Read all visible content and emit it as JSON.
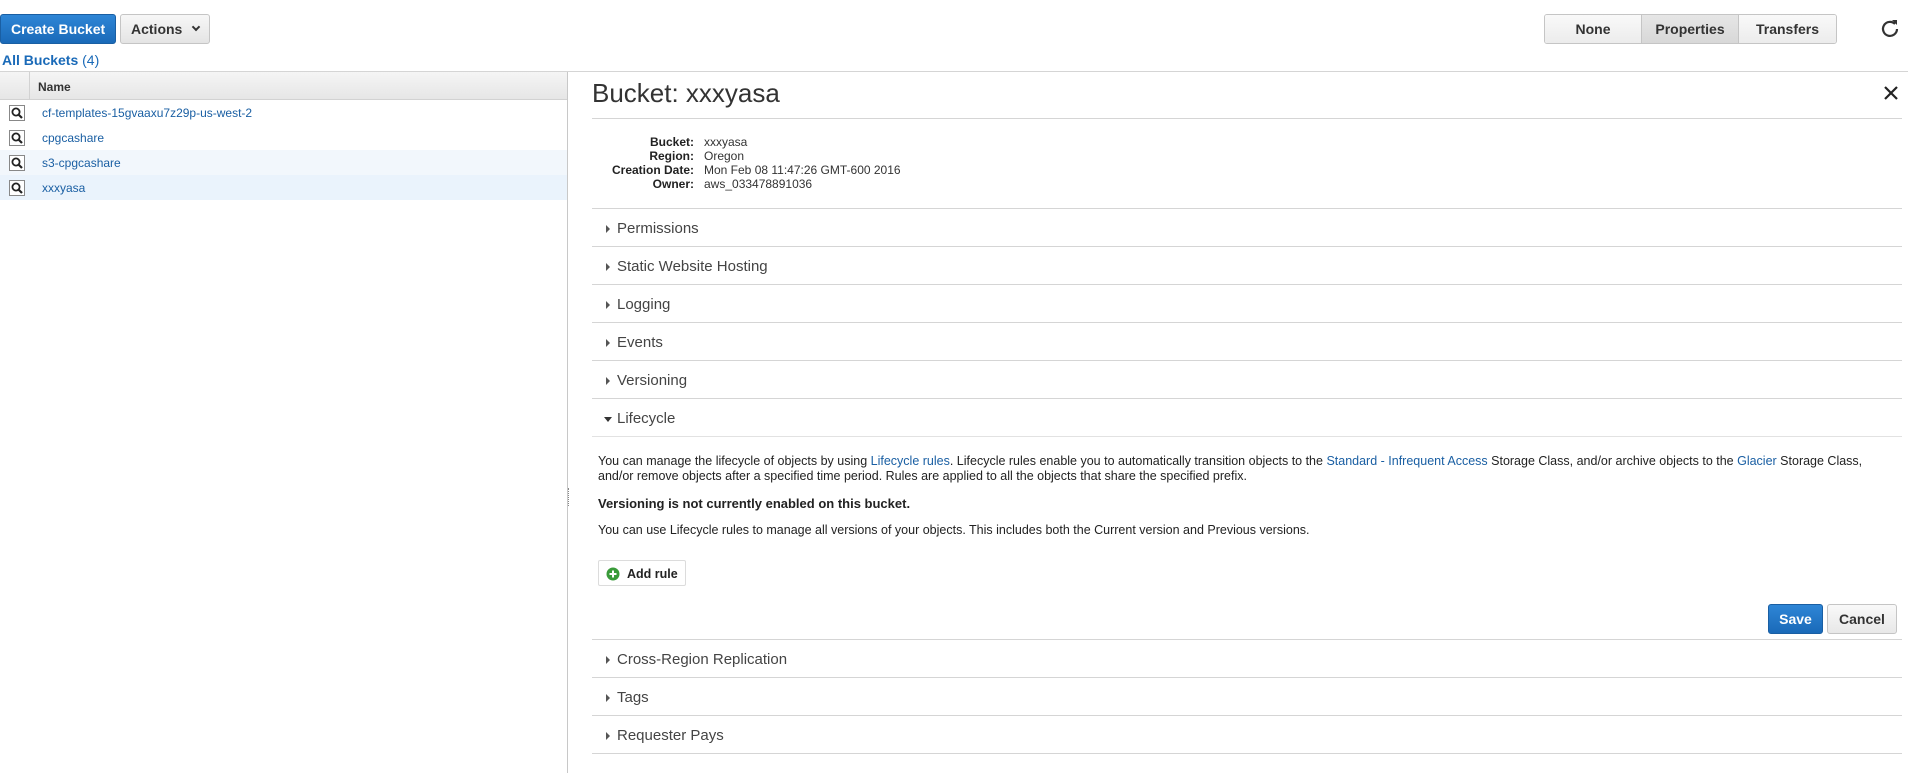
{
  "toolbar": {
    "create_bucket": "Create Bucket",
    "actions": "Actions",
    "view_tabs": [
      "None",
      "Properties",
      "Transfers"
    ],
    "active_tab": "Properties"
  },
  "all_buckets": {
    "label": "All Buckets",
    "count": "(4)"
  },
  "table": {
    "header_name": "Name",
    "rows": [
      "cf-templates-15gvaaxu7z29p-us-west-2",
      "cpgcashare",
      "s3-cpgcashare",
      "xxxyasa"
    ]
  },
  "details": {
    "title": "Bucket: xxxyasa",
    "meta": {
      "bucket_label": "Bucket:",
      "bucket_value": "xxxyasa",
      "region_label": "Region:",
      "region_value": "Oregon",
      "creation_label": "Creation Date:",
      "creation_value": "Mon Feb 08 11:47:26 GMT-600 2016",
      "owner_label": "Owner:",
      "owner_value": "aws_033478891036"
    },
    "sections": {
      "permissions": "Permissions",
      "static_hosting": "Static Website Hosting",
      "logging": "Logging",
      "events": "Events",
      "versioning": "Versioning",
      "lifecycle": "Lifecycle",
      "cross_region": "Cross-Region Replication",
      "tags": "Tags",
      "requester_pays": "Requester Pays"
    },
    "lifecycle": {
      "p1_a": "You can manage the lifecycle of objects by using ",
      "p1_link1": "Lifecycle rules",
      "p1_b": ". Lifecycle rules enable you to automatically transition objects to the ",
      "p1_link2": "Standard - Infrequent Access",
      "p1_c": " Storage Class, and/or archive objects to the ",
      "p1_link3": "Glacier",
      "p1_d": " Storage Class, and/or remove objects after a specified time period. Rules are applied to all the objects that share the specified prefix.",
      "warning": "Versioning is not currently enabled on this bucket.",
      "p3": "You can use Lifecycle rules to manage all versions of your objects. This includes both the Current version and Previous versions.",
      "add_rule": "Add rule",
      "save": "Save",
      "cancel": "Cancel"
    }
  },
  "colors": {
    "primary": "#1a6ab8",
    "link": "#1a5fa3",
    "selected_row": "#eaf3fc"
  }
}
